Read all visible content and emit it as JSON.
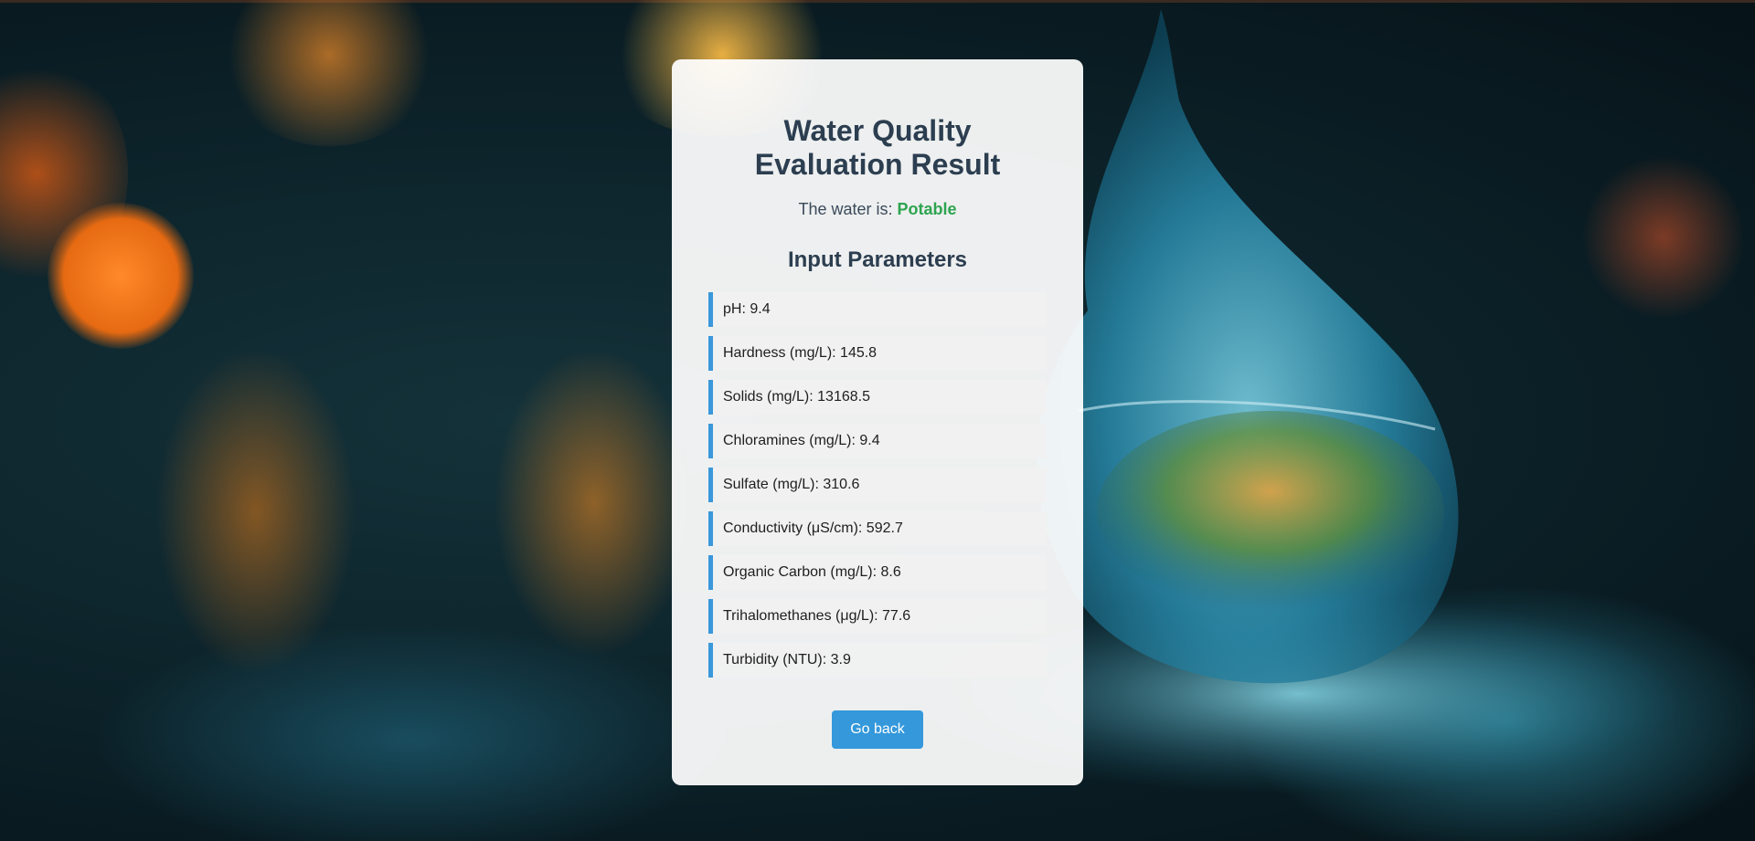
{
  "page": {
    "title_line1": "Water Quality",
    "title_line2": "Evaluation Result",
    "status_prefix": "The water is:",
    "status_value": "Potable",
    "status_color": "#2ea44f",
    "section_title": "Input Parameters",
    "back_button": "Go back"
  },
  "parameters": [
    "pH: 9.4",
    "Hardness (mg/L): 145.8",
    "Solids (mg/L): 13168.5",
    "Chloramines (mg/L): 9.4",
    "Sulfate (mg/L): 310.6",
    "Conductivity (μS/cm): 592.7",
    "Organic Carbon (mg/L): 8.6",
    "Trihalomethanes (μg/L): 77.6",
    "Turbidity (NTU): 3.9"
  ],
  "colors": {
    "accent": "#3498db",
    "heading": "#2c3e50"
  }
}
